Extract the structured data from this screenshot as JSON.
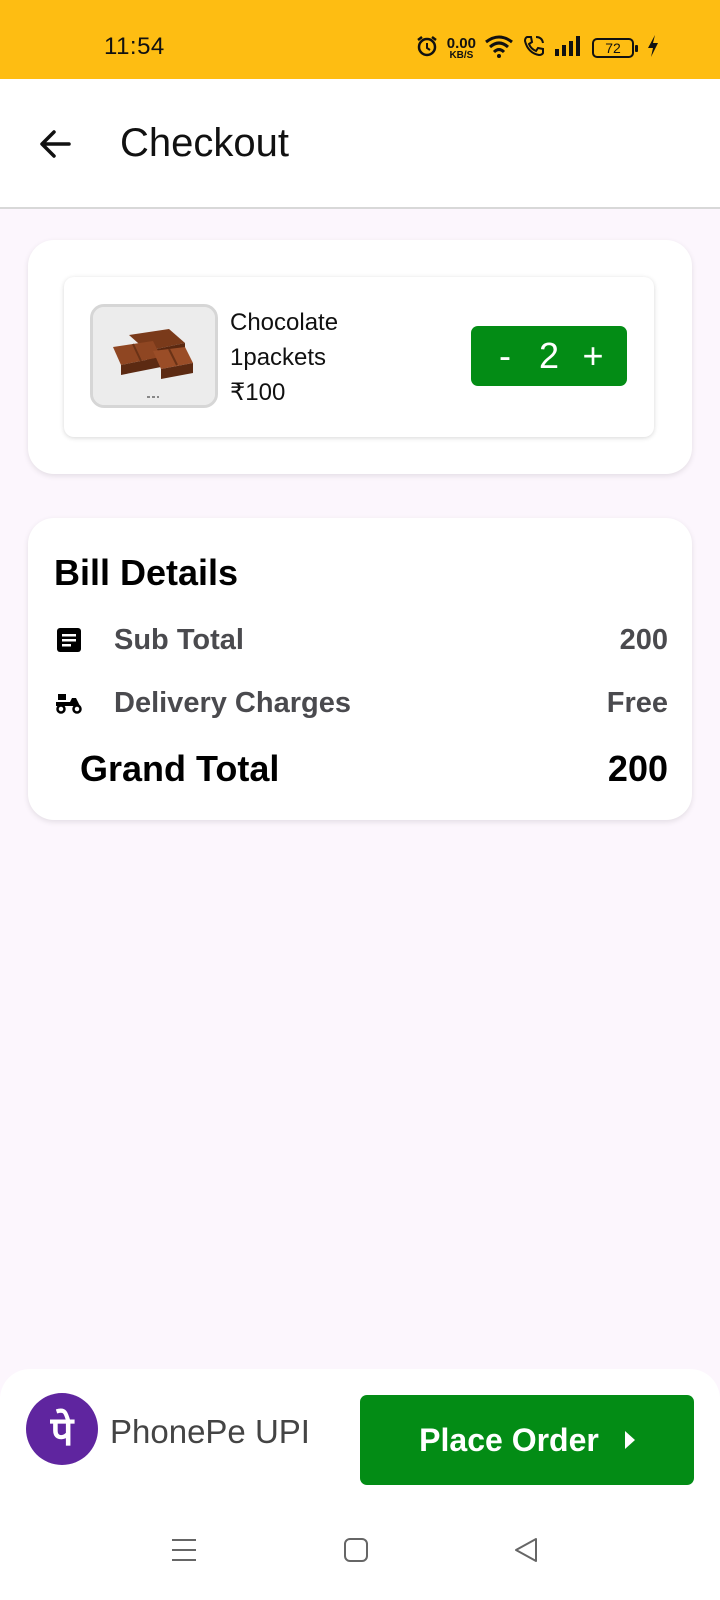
{
  "status_bar": {
    "time": "11:54",
    "net_speed_value": "0.00",
    "net_speed_unit": "KB/S",
    "battery": "72",
    "background": "#FEBD12"
  },
  "header": {
    "title": "Checkout",
    "back_icon": "arrow-left-icon"
  },
  "cart": {
    "items": [
      {
        "name": "Chocolate",
        "pack": "1packets",
        "price": "₹100",
        "quantity": "2",
        "decrement_label": "-",
        "increment_label": "+"
      }
    ]
  },
  "bill": {
    "title": "Bill Details",
    "sub_total_label": "Sub Total",
    "sub_total_value": "200",
    "delivery_label": "Delivery Charges",
    "delivery_value": "Free",
    "grand_total_label": "Grand Total",
    "grand_total_value": "200"
  },
  "footer": {
    "payment_logo_glyph": "पे",
    "payment_method": "PhonePe UPI",
    "place_order_label": "Place Order",
    "accent": "#038C15",
    "phonepe_color": "#5F259F"
  },
  "nav": {
    "icons": [
      "menu-icon",
      "home-square-icon",
      "back-triangle-icon"
    ]
  }
}
